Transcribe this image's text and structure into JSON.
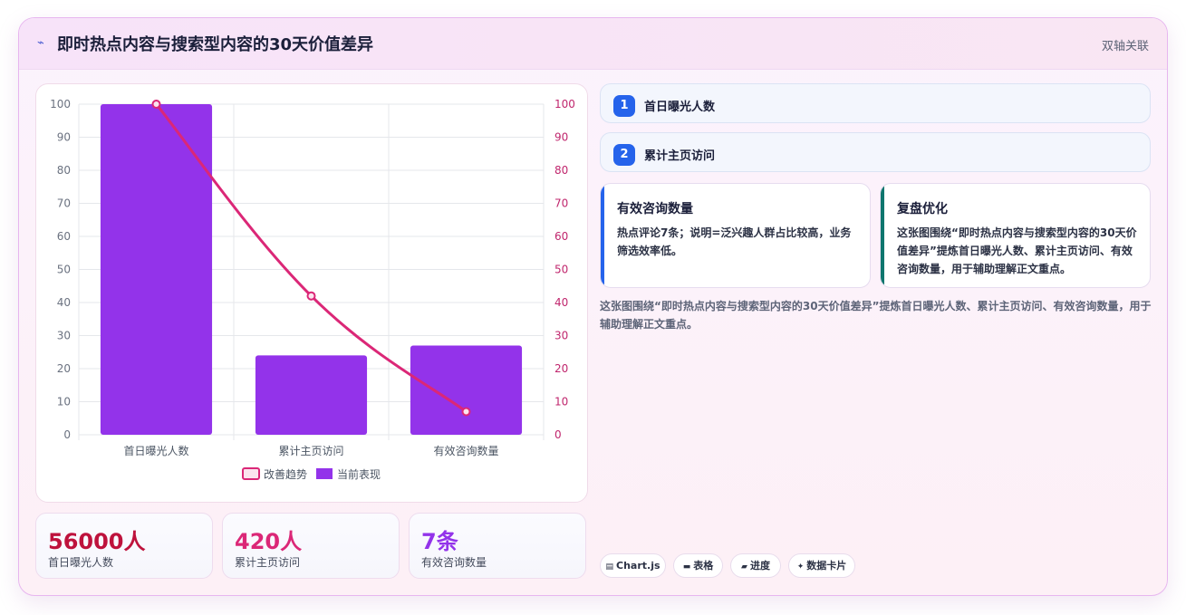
{
  "header": {
    "icon": "trend-icon",
    "title": "即时热点内容与搜索型内容的30天价值差异",
    "tag": "双轴关联"
  },
  "chart_data": {
    "type": "bar",
    "categories": [
      "首日曝光人数",
      "累计主页访问",
      "有效咨询数量"
    ],
    "series": [
      {
        "name": "当前表现",
        "type": "bar",
        "axis": "left",
        "values": [
          100,
          24,
          27
        ],
        "color": "#9333ea"
      },
      {
        "name": "改善趋势",
        "type": "line",
        "axis": "right",
        "values": [
          100,
          42,
          7
        ],
        "color": "#db2777"
      }
    ],
    "ylim": [
      0,
      100
    ],
    "y2lim": [
      0,
      100
    ],
    "yticks": [
      0,
      10,
      20,
      30,
      40,
      50,
      60,
      70,
      80,
      90,
      100
    ],
    "legend_position": "bottom",
    "grid": true
  },
  "stats": [
    {
      "value": "56000人",
      "label": "首日曝光人数",
      "color": "#be123c"
    },
    {
      "value": "420人",
      "label": "累计主页访问",
      "color": "#db2777"
    },
    {
      "value": "7条",
      "label": "有效咨询数量",
      "color": "#9333ea"
    }
  ],
  "steps": [
    {
      "num": "1",
      "label": "首日曝光人数"
    },
    {
      "num": "2",
      "label": "累计主页访问"
    }
  ],
  "notes": [
    {
      "title": "有效咨询数量",
      "body": "热点评论7条；说明=泛兴趣人群占比较高，业务筛选效率低。",
      "accent": "#2563eb"
    },
    {
      "title": "复盘优化",
      "body": "这张图围绕“即时热点内容与搜索型内容的30天价值差异”提炼首日曝光人数、累计主页访问、有效咨询数量，用于辅助理解正文重点。",
      "accent": "#0f766e"
    }
  ],
  "summary": "这张图围绕“即时热点内容与搜索型内容的30天价值差异”提炼首日曝光人数、累计主页访问、有效咨询数量，用于辅助理解正文重点。",
  "chips": [
    {
      "icon": "chart-icon",
      "glyph": "▤",
      "label": "Chart.js"
    },
    {
      "icon": "table-icon",
      "glyph": "▬",
      "label": "表格"
    },
    {
      "icon": "progress-icon",
      "glyph": "▰",
      "label": "进度"
    },
    {
      "icon": "sparkle-icon",
      "glyph": "✦",
      "label": "数据卡片"
    }
  ]
}
